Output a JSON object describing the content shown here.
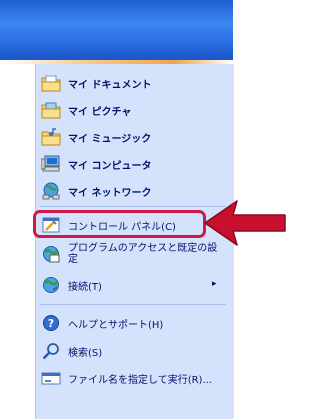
{
  "menu": {
    "items": [
      {
        "label": "マイ ドキュメント",
        "icon": "my-documents-icon"
      },
      {
        "label": "マイ ピクチャ",
        "icon": "my-pictures-icon"
      },
      {
        "label": "マイ ミュージック",
        "icon": "my-music-icon"
      },
      {
        "label": "マイ コンピュータ",
        "icon": "my-computer-icon"
      },
      {
        "label": "マイ ネットワーク",
        "icon": "my-network-icon"
      }
    ],
    "control_panel": {
      "label": "コントロール パネル(C)",
      "icon": "control-panel-icon"
    },
    "program_access": {
      "label_line1": "プログラムのアクセスと既定の設",
      "label_line2": "定",
      "icon": "program-access-icon"
    },
    "connect": {
      "label": "接続(T)",
      "icon": "globe-icon",
      "arrow": "▸"
    },
    "help": {
      "label": "ヘルプとサポート(H)",
      "icon": "help-icon"
    },
    "search": {
      "label": "検索(S)",
      "icon": "search-icon"
    },
    "run": {
      "label": "ファイル名を指定して実行(R)...",
      "icon": "run-icon"
    }
  },
  "colors": {
    "highlight_border": "#cc1a4a",
    "arrow": "#c8102e",
    "panel_bg": "#d4e3fb",
    "titlebar": "#2a6ee4"
  }
}
